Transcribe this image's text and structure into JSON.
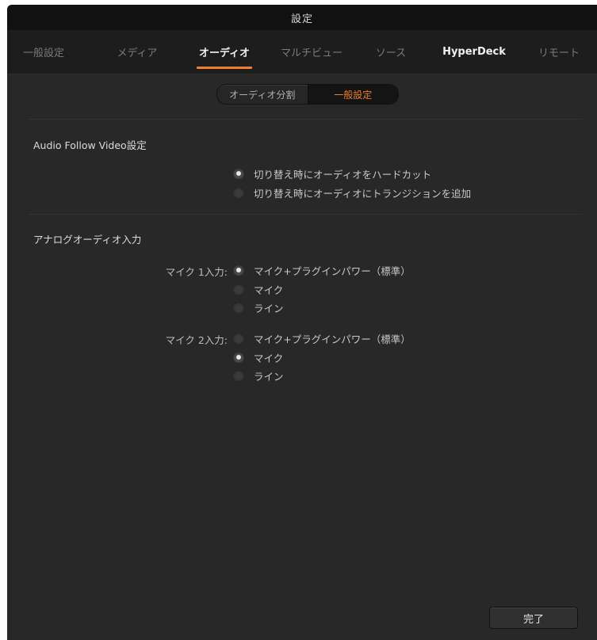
{
  "window": {
    "title": "設定"
  },
  "tabs": [
    {
      "label": "一般設定",
      "active": false
    },
    {
      "label": "メディア",
      "active": false
    },
    {
      "label": "オーディオ",
      "active": true
    },
    {
      "label": "マルチビュー",
      "active": false
    },
    {
      "label": "ソース",
      "active": false
    },
    {
      "label": "HyperDeck",
      "active": false
    },
    {
      "label": "リモート",
      "active": false
    }
  ],
  "subtabs": [
    {
      "label": "オーディオ分割",
      "active": false
    },
    {
      "label": "一般設定",
      "active": true
    }
  ],
  "afv": {
    "title": "Audio Follow Video設定",
    "options": [
      {
        "label": "切り替え時にオーディオをハードカット",
        "checked": true
      },
      {
        "label": "切り替え時にオーディオにトランジションを追加",
        "checked": false
      }
    ]
  },
  "analog": {
    "title": "アナログオーディオ入力",
    "mic1": {
      "label": "マイク 1入力:",
      "options": [
        {
          "label": "マイク+プラグインパワー（標準）",
          "checked": true
        },
        {
          "label": "マイク",
          "checked": false
        },
        {
          "label": "ライン",
          "checked": false
        }
      ]
    },
    "mic2": {
      "label": "マイク 2入力:",
      "options": [
        {
          "label": "マイク+プラグインパワー（標準）",
          "checked": false
        },
        {
          "label": "マイク",
          "checked": true
        },
        {
          "label": "ライン",
          "checked": false
        }
      ]
    }
  },
  "footer": {
    "done_label": "完了"
  },
  "colors": {
    "accent": "#f07f2c",
    "background": "#282828",
    "titlebar": "#111111",
    "tabbar": "#1d1d1d"
  }
}
